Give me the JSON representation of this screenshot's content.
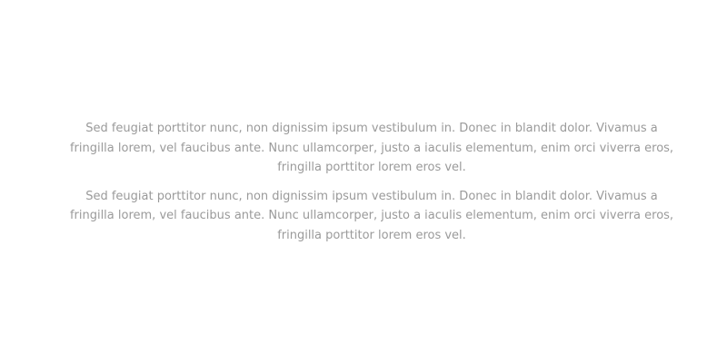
{
  "main": {
    "paragraphs": [
      "Sed feugiat porttitor nunc, non dignissim ipsum vestibulum in. Donec in blandit dolor. Vivamus a fringilla lorem, vel faucibus ante. Nunc ullamcorper, justo a iaculis elementum, enim orci viverra eros, fringilla porttitor lorem eros vel.",
      "Sed feugiat porttitor nunc, non dignissim ipsum vestibulum in. Donec in blandit dolor. Vivamus a fringilla lorem, vel faucibus ante. Nunc ullamcorper, justo a iaculis elementum, enim orci viverra eros, fringilla porttitor lorem eros vel."
    ]
  },
  "colors": {
    "background": "#ffffff",
    "text": "#9a9a9a"
  }
}
